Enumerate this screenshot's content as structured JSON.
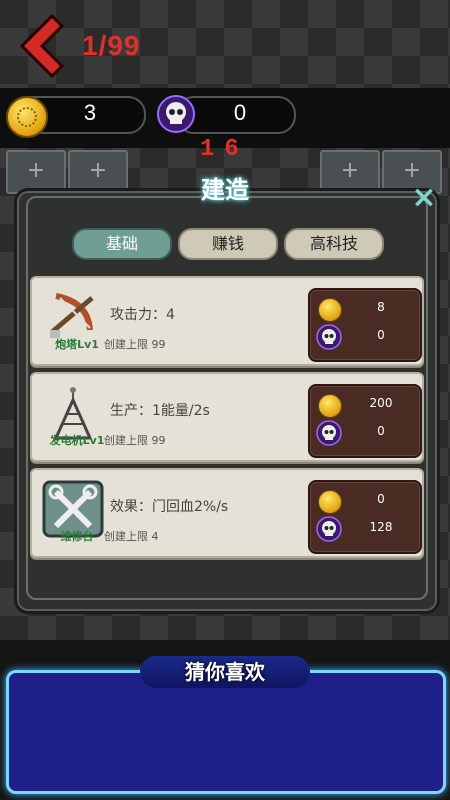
{
  "hud": {
    "level": "1/99",
    "coins": "3",
    "skulls": "0",
    "countdown": "16"
  },
  "dialog": {
    "title": "建造",
    "close_label": "×",
    "tabs": [
      {
        "label": "基础",
        "active": true
      },
      {
        "label": "赚钱",
        "active": false
      },
      {
        "label": "高科技",
        "active": false
      }
    ],
    "items": [
      {
        "name": "炮塔Lv1",
        "stat": "攻击力：4",
        "limit": "创建上限 99",
        "coin_cost": "8",
        "skull_cost": "0",
        "icon": "crossbow-icon"
      },
      {
        "name": "发电机Lv1",
        "stat": "生产：1能量/2s",
        "limit": "创建上限 99",
        "coin_cost": "200",
        "skull_cost": "0",
        "icon": "generator-icon"
      },
      {
        "name": "维修台",
        "stat": "效果：门回血2%/s",
        "limit": "创建上限 4",
        "coin_cost": "0",
        "skull_cost": "128",
        "icon": "wrench-icon"
      }
    ]
  },
  "ad": {
    "title": "猜你喜欢"
  },
  "colors": {
    "accent_red": "#e0302a",
    "tab_active": "#6f9e95",
    "cost_bg": "#4a2b24",
    "ad_border": "#7ad7ff"
  },
  "icons": {
    "back": "back-arrow-icon",
    "coin": "coin-icon",
    "skull": "skull-icon",
    "close": "close-icon",
    "slot_add": "plus-icon"
  }
}
